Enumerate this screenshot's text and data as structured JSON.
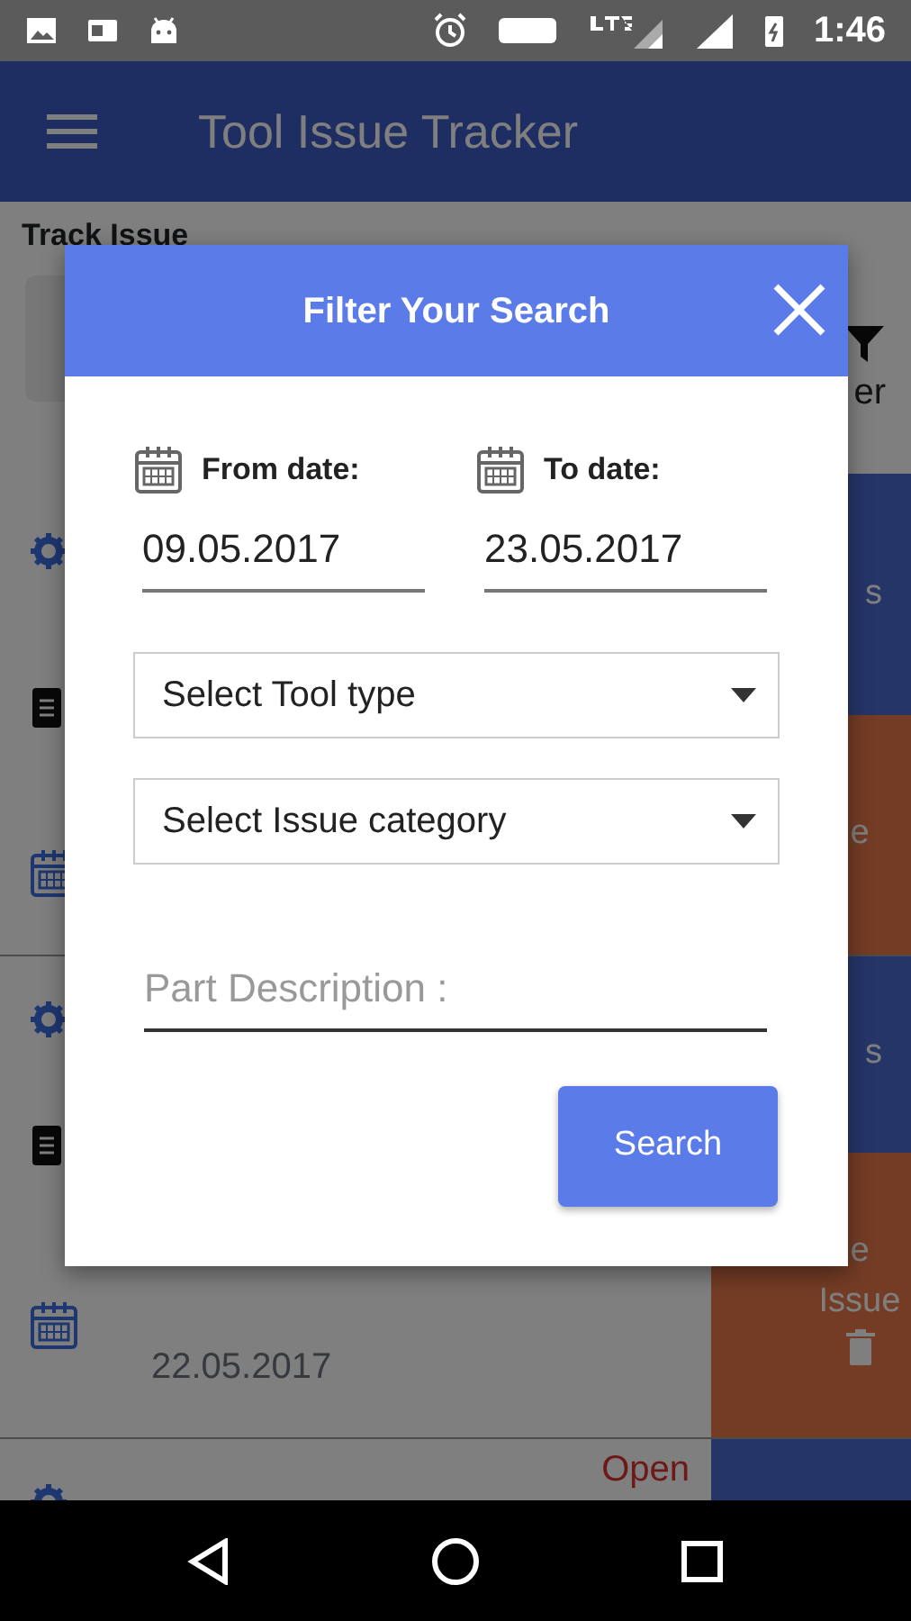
{
  "status_bar": {
    "time": "1:46"
  },
  "app_bar": {
    "title": "Tool Issue Tracker"
  },
  "page": {
    "heading": "Track Issue",
    "filter_label": "er"
  },
  "issues": [
    {
      "top_action": "s",
      "bottom_action": [
        "e"
      ]
    },
    {
      "top_action": "s",
      "bottom_action": [
        "e",
        "Issue"
      ],
      "reported_date": "22.05.2017"
    },
    {
      "status": "Open"
    }
  ],
  "dialog": {
    "title": "Filter Your Search",
    "dates": [
      {
        "label": "From date:",
        "value": "09.05.2017"
      },
      {
        "label": "To date:",
        "value": "23.05.2017"
      }
    ],
    "selects": [
      {
        "placeholder": "Select Tool type"
      },
      {
        "placeholder": "Select Issue category"
      }
    ],
    "part_description": {
      "placeholder": "Part Description :"
    },
    "button": "Search"
  }
}
